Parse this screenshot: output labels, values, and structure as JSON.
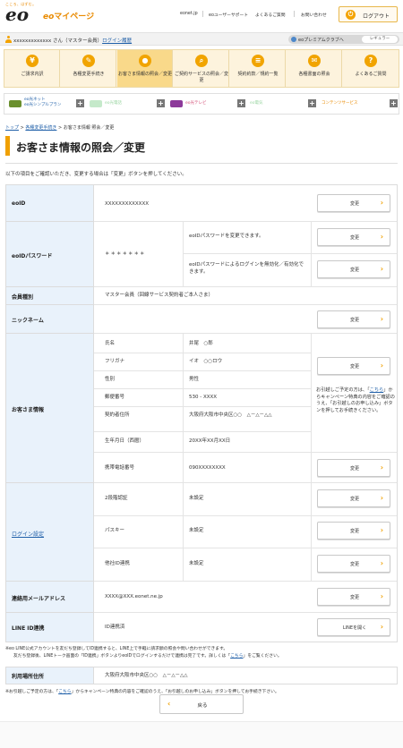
{
  "header": {
    "tagline": "こころ、はずむ。",
    "logo": "eo",
    "app_title": "マイページ",
    "links": [
      "eonet.jp",
      "eoユーザーサポート",
      "よくあるご質問",
      "お問い合わせ"
    ],
    "logout_label": "ログアウト"
  },
  "userbar": {
    "user_text": "xxxxxxxxxxxxx さん（マスター会員）",
    "login_history": "ログイン履歴",
    "premium_label": "eoプレミアムクラブへ",
    "premium_rank": "レギュラー"
  },
  "mainnav": [
    {
      "label": "ご請求内訳",
      "icon": "yen-icon",
      "glyph": "¥"
    },
    {
      "label": "各種変更手続き",
      "icon": "edit-icon",
      "glyph": "✎"
    },
    {
      "label": "お客さま情報の照会／変更",
      "icon": "person-icon",
      "glyph": "●",
      "active": true
    },
    {
      "label": "ご契約サービスの照会／変更",
      "icon": "search-icon",
      "glyph": "⌕"
    },
    {
      "label": "契約約款／規約一覧",
      "icon": "document-icon",
      "glyph": "≡"
    },
    {
      "label": "各種書面の照会",
      "icon": "mail-icon",
      "glyph": "✉"
    },
    {
      "label": "よくあるご質問",
      "icon": "question-icon",
      "glyph": "?"
    }
  ],
  "services": [
    {
      "label1": "eo光ネット",
      "label2": "eo光シンプルプラン",
      "color": "#1f5fa8",
      "icon_color": "#6a8f2d",
      "dim": false
    },
    {
      "label1": "eo光電話",
      "label2": "",
      "color": "#7fcf8a",
      "icon_color": "#7fcf8a",
      "dim": true
    },
    {
      "label1": "eo光テレビ",
      "label2": "",
      "color": "#d4547b",
      "icon_color": "#8d3a9a",
      "dim": false
    },
    {
      "label1": "eo電気",
      "label2": "",
      "color": "#9dd6a4",
      "icon_color": "#9dd6a4",
      "dim": true
    },
    {
      "label1": "コンテンツサービス",
      "label2": "",
      "color": "#e98a00",
      "icon_color": "#e98a00",
      "dim": false
    }
  ],
  "breadcrumb": {
    "top": "トップ",
    "sep": ">",
    "mid": "各種変更手続き",
    "current": "お客さま情報 照会／変更"
  },
  "page": {
    "title": "お客さま情報の照会／変更",
    "intro": "以下の項目をご確認いただき、変更する場合は「変更」ボタンを押してください。"
  },
  "table": {
    "eoid": {
      "label": "eoID",
      "value": "XXXXXXXXXXXXX",
      "button": "変更"
    },
    "password": {
      "label": "eoIDパスワード",
      "value": "＊＊＊＊＊＊＊",
      "desc1": "eoIDパスワードを変更できます。",
      "desc2": "eoIDパスワードによるログインを無効化／有効化できます。",
      "button1": "変更",
      "button2": "変更"
    },
    "member_type": {
      "label": "会員種別",
      "value": "マスター会員（回線サービス契約者ご本人さま）"
    },
    "nickname": {
      "label": "ニックネーム",
      "value": "",
      "button": "変更"
    },
    "customer": {
      "label": "お客さま情報",
      "rows": [
        {
          "k": "氏名",
          "v": "井尾　○郎"
        },
        {
          "k": "フリガナ",
          "v": "イオ　○○ロウ"
        },
        {
          "k": "性別",
          "v": "男性"
        },
        {
          "k": "郵便番号",
          "v": "530 - XXXX"
        },
        {
          "k": "契約者住所",
          "v": "大阪府大阪市中央区○○　△－△－△△"
        },
        {
          "k": "生年月日（西暦）",
          "v": "20XX年XX月XX日"
        },
        {
          "k": "携帯電話番号",
          "v": "090XXXXXXXX"
        }
      ],
      "button1": "変更",
      "move_note_pre": "お引越しご予定の方は、「",
      "move_note_link": "こちら",
      "move_note_post": "」からキャンペーン特典の内容をご確認のうえ、「お引越しのお申し込み」ボタンを押してお手続きください。",
      "button2": "変更"
    },
    "login": {
      "label": "ログイン設定",
      "rows": [
        {
          "k": "2段階認証",
          "v": "未設定",
          "button": "変更"
        },
        {
          "k": "パスキー",
          "v": "未設定",
          "button": "変更"
        },
        {
          "k": "他社ID連携",
          "v": "未設定",
          "button": "変更"
        }
      ]
    },
    "email": {
      "label": "連絡用メールアドレス",
      "value": "XXXX@XXX.eonet.ne.jp",
      "button": "変更"
    },
    "line": {
      "label": "LINE ID連携",
      "value": "ID連携済",
      "button": "LINEを開く"
    }
  },
  "notes": {
    "line_note1": "※eo LINE公式アカウントを友だち登録してID連携すると、LINE上で手軽に請求額の照会や問い合わせができます。",
    "line_note2_pre": "友だち登録後、LINEトーク画面の「ID連携」ボタンよりeoIDでログインするだけで連携は完了です。詳しくは「",
    "line_note2_link": "こちら",
    "line_note2_post": "」をご覧ください。",
    "usage_label": "利用場所住所",
    "usage_value": "大阪府大阪市中央区○○　△－△－△△",
    "move_pre": "※お引越しご予定の方は、「",
    "move_link": "こちら",
    "move_post": "」からキャンペーン特典の内容をご確認のうえ、「お引越しのお申し込み」ボタンを押してお手続き下さい。"
  },
  "back_label": "戻る",
  "colors": {
    "accent": "#f0a000",
    "label_bg": "#e9f2fb",
    "link": "#1f5fa8"
  }
}
